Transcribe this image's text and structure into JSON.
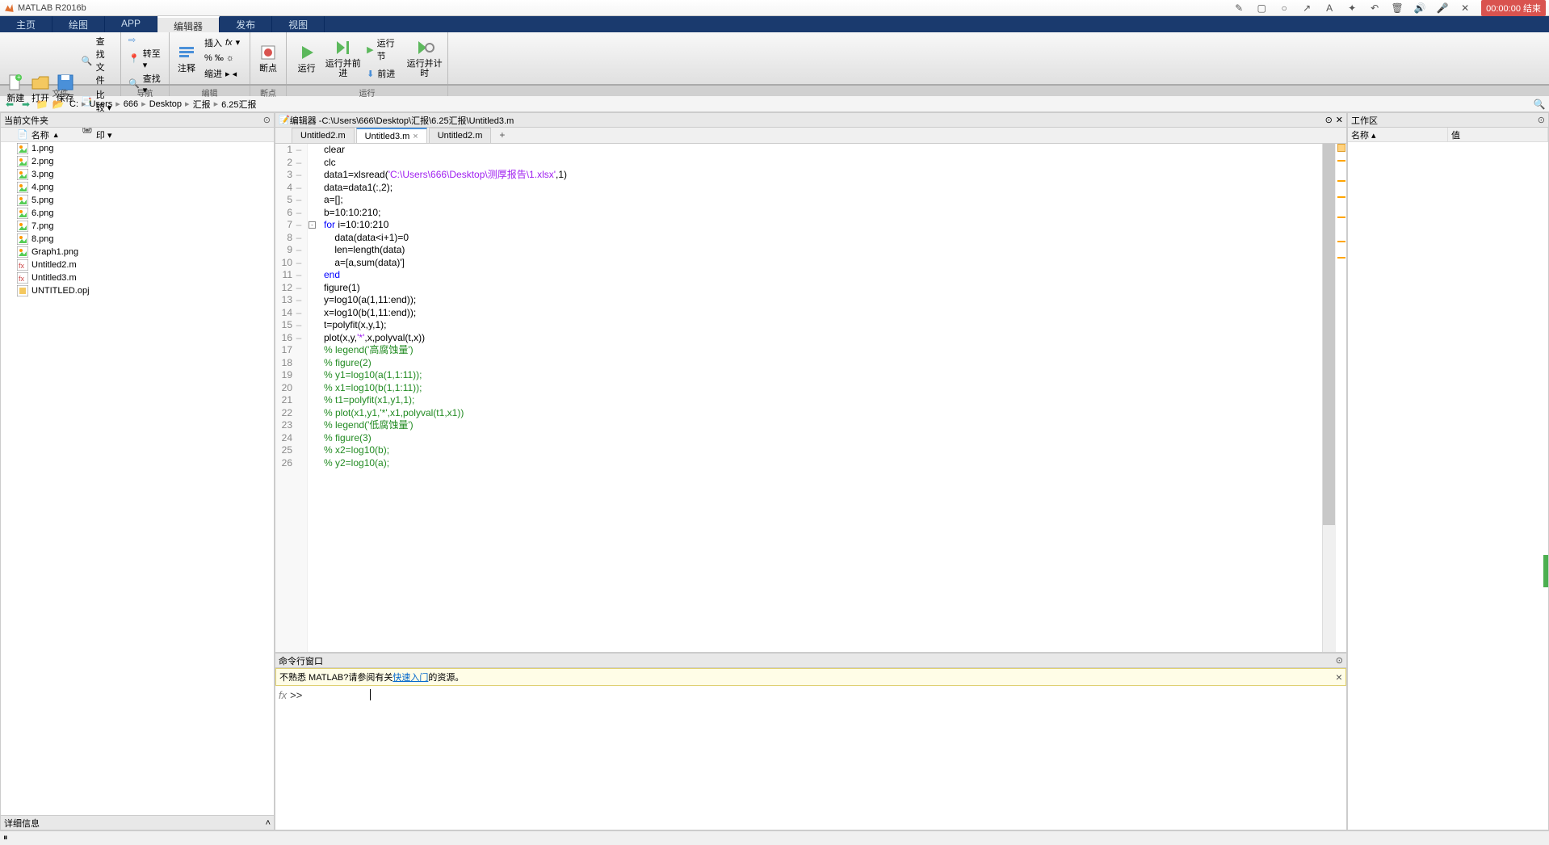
{
  "app": {
    "title": "MATLAB R2016b"
  },
  "recording": {
    "badge": "00:00:00 结束"
  },
  "toolstrip_tabs": [
    "主页",
    "绘图",
    "APP",
    "编辑器",
    "发布",
    "视图"
  ],
  "toolstrip_active_index": 3,
  "ribbon": {
    "groups": [
      {
        "label": "文件",
        "big": [
          {
            "label": "新建",
            "icon": "plus"
          },
          {
            "label": "打开",
            "icon": "folder"
          },
          {
            "label": "保存",
            "icon": "save"
          }
        ],
        "small": [
          {
            "label": "查找文件",
            "icon": "search-doc"
          },
          {
            "label": "比较 ▾",
            "icon": "compare"
          },
          {
            "label": "打印 ▾",
            "icon": "print"
          }
        ]
      },
      {
        "label": "导航",
        "small": [
          {
            "label": "",
            "icon": "goto-arrow"
          },
          {
            "label": "转至 ▾",
            "icon": "goto"
          },
          {
            "label": "查找 ▾",
            "icon": "find"
          }
        ]
      },
      {
        "label": "编辑",
        "big": [
          {
            "label": "注释",
            "icon": "comment"
          }
        ],
        "small_rows": [
          {
            "labels": [
              "插入",
              "",
              "fx",
              ""
            ],
            "icon": "insert"
          },
          {
            "labels": [
              "%",
              "‰",
              "☼"
            ]
          },
          {
            "labels": [
              "缩进",
              "",
              "",
              ""
            ]
          }
        ]
      },
      {
        "label": "断点",
        "big": [
          {
            "label": "断点",
            "icon": "breakpoint"
          }
        ]
      },
      {
        "label": "运行",
        "big": [
          {
            "label": "运行",
            "icon": "run"
          },
          {
            "label": "运行并前进",
            "icon": "run-advance"
          },
          {
            "label": "运行节",
            "icon": "run-section"
          },
          {
            "label": "运行并计时",
            "icon": "run-time"
          }
        ],
        "small": [
          {
            "label": "前进",
            "icon": "advance"
          }
        ]
      }
    ]
  },
  "breadcrumb": [
    "C:",
    "Users",
    "666",
    "Desktop",
    "汇报",
    "6.25汇报"
  ],
  "current_folder": {
    "title": "当前文件夹",
    "name_col": "名称",
    "details": "详细信息",
    "files": [
      {
        "name": "1.png",
        "type": "png"
      },
      {
        "name": "2.png",
        "type": "png"
      },
      {
        "name": "3.png",
        "type": "png"
      },
      {
        "name": "4.png",
        "type": "png"
      },
      {
        "name": "5.png",
        "type": "png"
      },
      {
        "name": "6.png",
        "type": "png"
      },
      {
        "name": "7.png",
        "type": "png"
      },
      {
        "name": "8.png",
        "type": "png"
      },
      {
        "name": "Graph1.png",
        "type": "png"
      },
      {
        "name": "Untitled2.m",
        "type": "m"
      },
      {
        "name": "Untitled3.m",
        "type": "m"
      },
      {
        "name": "UNTITLED.opj",
        "type": "opj"
      }
    ]
  },
  "editor": {
    "title_prefix": "编辑器 - ",
    "path": "C:\\Users\\666\\Desktop\\汇报\\6.25汇报\\Untitled3.m",
    "tabs": [
      {
        "label": "Untitled2.m",
        "active": false
      },
      {
        "label": "Untitled3.m",
        "active": true
      },
      {
        "label": "Untitled2.m",
        "active": false
      }
    ],
    "lines": [
      {
        "n": 1,
        "dash": "–",
        "code": [
          {
            "t": "clear",
            "c": null
          }
        ]
      },
      {
        "n": 2,
        "dash": "–",
        "code": [
          {
            "t": "clc",
            "c": null
          }
        ]
      },
      {
        "n": 3,
        "dash": "–",
        "code": [
          {
            "t": "data1=xlsread(",
            "c": null
          },
          {
            "t": "'C:\\Users\\666\\Desktop\\测厚报告\\1.xlsx'",
            "c": "str"
          },
          {
            "t": ",1)",
            "c": null
          }
        ]
      },
      {
        "n": 4,
        "dash": "–",
        "code": [
          {
            "t": "data=data1(:,2);",
            "c": null
          }
        ]
      },
      {
        "n": 5,
        "dash": "–",
        "code": [
          {
            "t": "a=[];",
            "c": null
          }
        ]
      },
      {
        "n": 6,
        "dash": "–",
        "code": [
          {
            "t": "b=10:10:210;",
            "c": null
          }
        ]
      },
      {
        "n": 7,
        "dash": "–",
        "fold": "-",
        "code": [
          {
            "t": "for ",
            "c": "kw"
          },
          {
            "t": "i=10:10:210",
            "c": null
          }
        ]
      },
      {
        "n": 8,
        "dash": "–",
        "code": [
          {
            "t": "    data(data<i+1)=0",
            "c": null
          }
        ]
      },
      {
        "n": 9,
        "dash": "–",
        "code": [
          {
            "t": "    len=length(data)",
            "c": null
          }
        ]
      },
      {
        "n": 10,
        "dash": "–",
        "code": [
          {
            "t": "    a=[a,sum(data)']",
            "c": null
          }
        ]
      },
      {
        "n": 11,
        "dash": "–",
        "code": [
          {
            "t": "end",
            "c": "kw"
          }
        ]
      },
      {
        "n": 12,
        "dash": "–",
        "code": [
          {
            "t": "figure(1)",
            "c": null
          }
        ]
      },
      {
        "n": 13,
        "dash": "–",
        "code": [
          {
            "t": "y=log10(a(1,11:end));",
            "c": null
          }
        ]
      },
      {
        "n": 14,
        "dash": "–",
        "code": [
          {
            "t": "x=log10(b(1,11:end));",
            "c": null
          }
        ]
      },
      {
        "n": 15,
        "dash": "–",
        "code": [
          {
            "t": "t=polyfit(x,y,1);",
            "c": null
          }
        ]
      },
      {
        "n": 16,
        "dash": "–",
        "code": [
          {
            "t": "plot(x,y,",
            "c": null
          },
          {
            "t": "'*'",
            "c": "str"
          },
          {
            "t": ",x,polyval(t,x))",
            "c": null
          }
        ]
      },
      {
        "n": 17,
        "dash": "",
        "code": [
          {
            "t": "% legend('高腐蚀量')",
            "c": "cmt"
          }
        ]
      },
      {
        "n": 18,
        "dash": "",
        "code": [
          {
            "t": "% figure(2)",
            "c": "cmt"
          }
        ]
      },
      {
        "n": 19,
        "dash": "",
        "code": [
          {
            "t": "% y1=log10(a(1,1:11));",
            "c": "cmt"
          }
        ]
      },
      {
        "n": 20,
        "dash": "",
        "code": [
          {
            "t": "% x1=log10(b(1,1:11));",
            "c": "cmt"
          }
        ]
      },
      {
        "n": 21,
        "dash": "",
        "code": [
          {
            "t": "% t1=polyfit(x1,y1,1);",
            "c": "cmt"
          }
        ]
      },
      {
        "n": 22,
        "dash": "",
        "code": [
          {
            "t": "% plot(x1,y1,'*',x1,polyval(t1,x1))",
            "c": "cmt"
          }
        ]
      },
      {
        "n": 23,
        "dash": "",
        "code": [
          {
            "t": "% legend('低腐蚀量')",
            "c": "cmt"
          }
        ]
      },
      {
        "n": 24,
        "dash": "",
        "code": [
          {
            "t": "% figure(3)",
            "c": "cmt"
          }
        ]
      },
      {
        "n": 25,
        "dash": "",
        "code": [
          {
            "t": "% x2=log10(b);",
            "c": "cmt"
          }
        ]
      },
      {
        "n": 26,
        "dash": "",
        "code": [
          {
            "t": "% y2=log10(a);",
            "c": "cmt"
          }
        ]
      }
    ]
  },
  "command": {
    "title": "命令行窗口",
    "banner_pre": "不熟悉 MATLAB?请参阅有关",
    "banner_link": "快速入门",
    "banner_post": "的资源。",
    "fx": "fx",
    "prompt": ">>"
  },
  "workspace": {
    "title": "工作区",
    "cols": [
      "名称 ▴",
      "值"
    ]
  }
}
